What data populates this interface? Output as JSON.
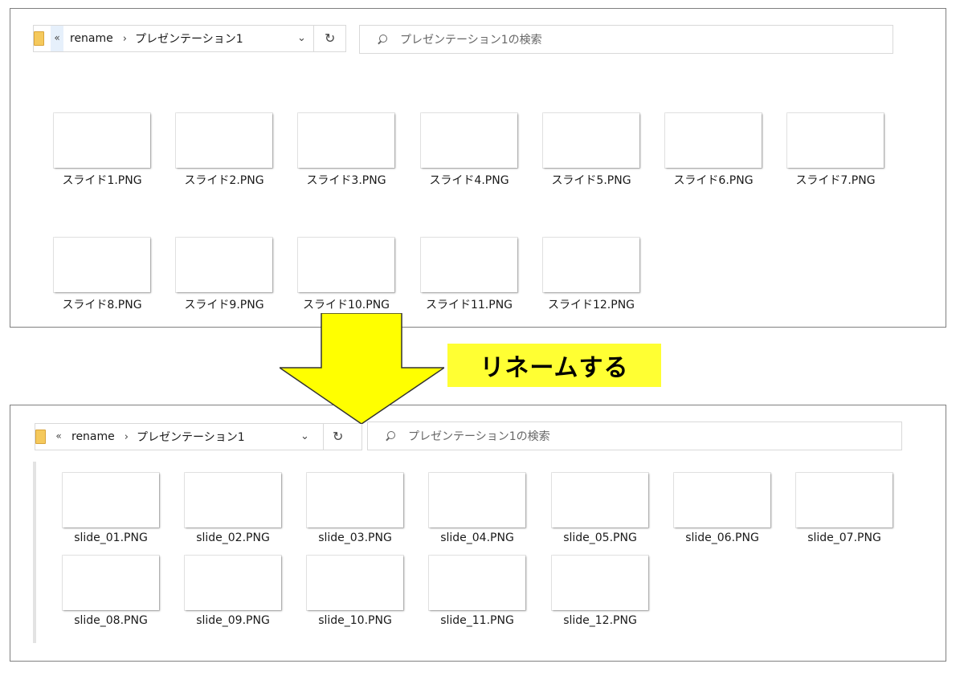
{
  "before": {
    "breadcrumb": {
      "back": "«",
      "root": "rename",
      "sep": "›",
      "current": "プレゼンテーション1",
      "dropdown": "⌄",
      "refresh": "↻"
    },
    "search_placeholder": "プレゼンテーション1の検索",
    "files": [
      "スライド1.PNG",
      "スライド2.PNG",
      "スライド3.PNG",
      "スライド4.PNG",
      "スライド5.PNG",
      "スライド6.PNG",
      "スライド7.PNG",
      "スライド8.PNG",
      "スライド9.PNG",
      "スライド10.PNG",
      "スライド11.PNG",
      "スライド12.PNG"
    ]
  },
  "callout": {
    "text": "リネームする",
    "color": "#ffff33"
  },
  "after": {
    "breadcrumb": {
      "back": "«",
      "root": "rename",
      "sep": "›",
      "current": "プレゼンテーション1",
      "dropdown": "⌄",
      "refresh": "↻"
    },
    "search_placeholder": "プレゼンテーション1の検索",
    "files": [
      "slide_01.PNG",
      "slide_02.PNG",
      "slide_03.PNG",
      "slide_04.PNG",
      "slide_05.PNG",
      "slide_06.PNG",
      "slide_07.PNG",
      "slide_08.PNG",
      "slide_09.PNG",
      "slide_10.PNG",
      "slide_11.PNG",
      "slide_12.PNG"
    ]
  },
  "icons": {
    "folder": "folder-icon",
    "search": "search-icon",
    "refresh": "refresh-icon",
    "dropdown": "chevron-down-icon",
    "back": "back-chevrons-icon",
    "arrow": "down-arrow-icon"
  }
}
